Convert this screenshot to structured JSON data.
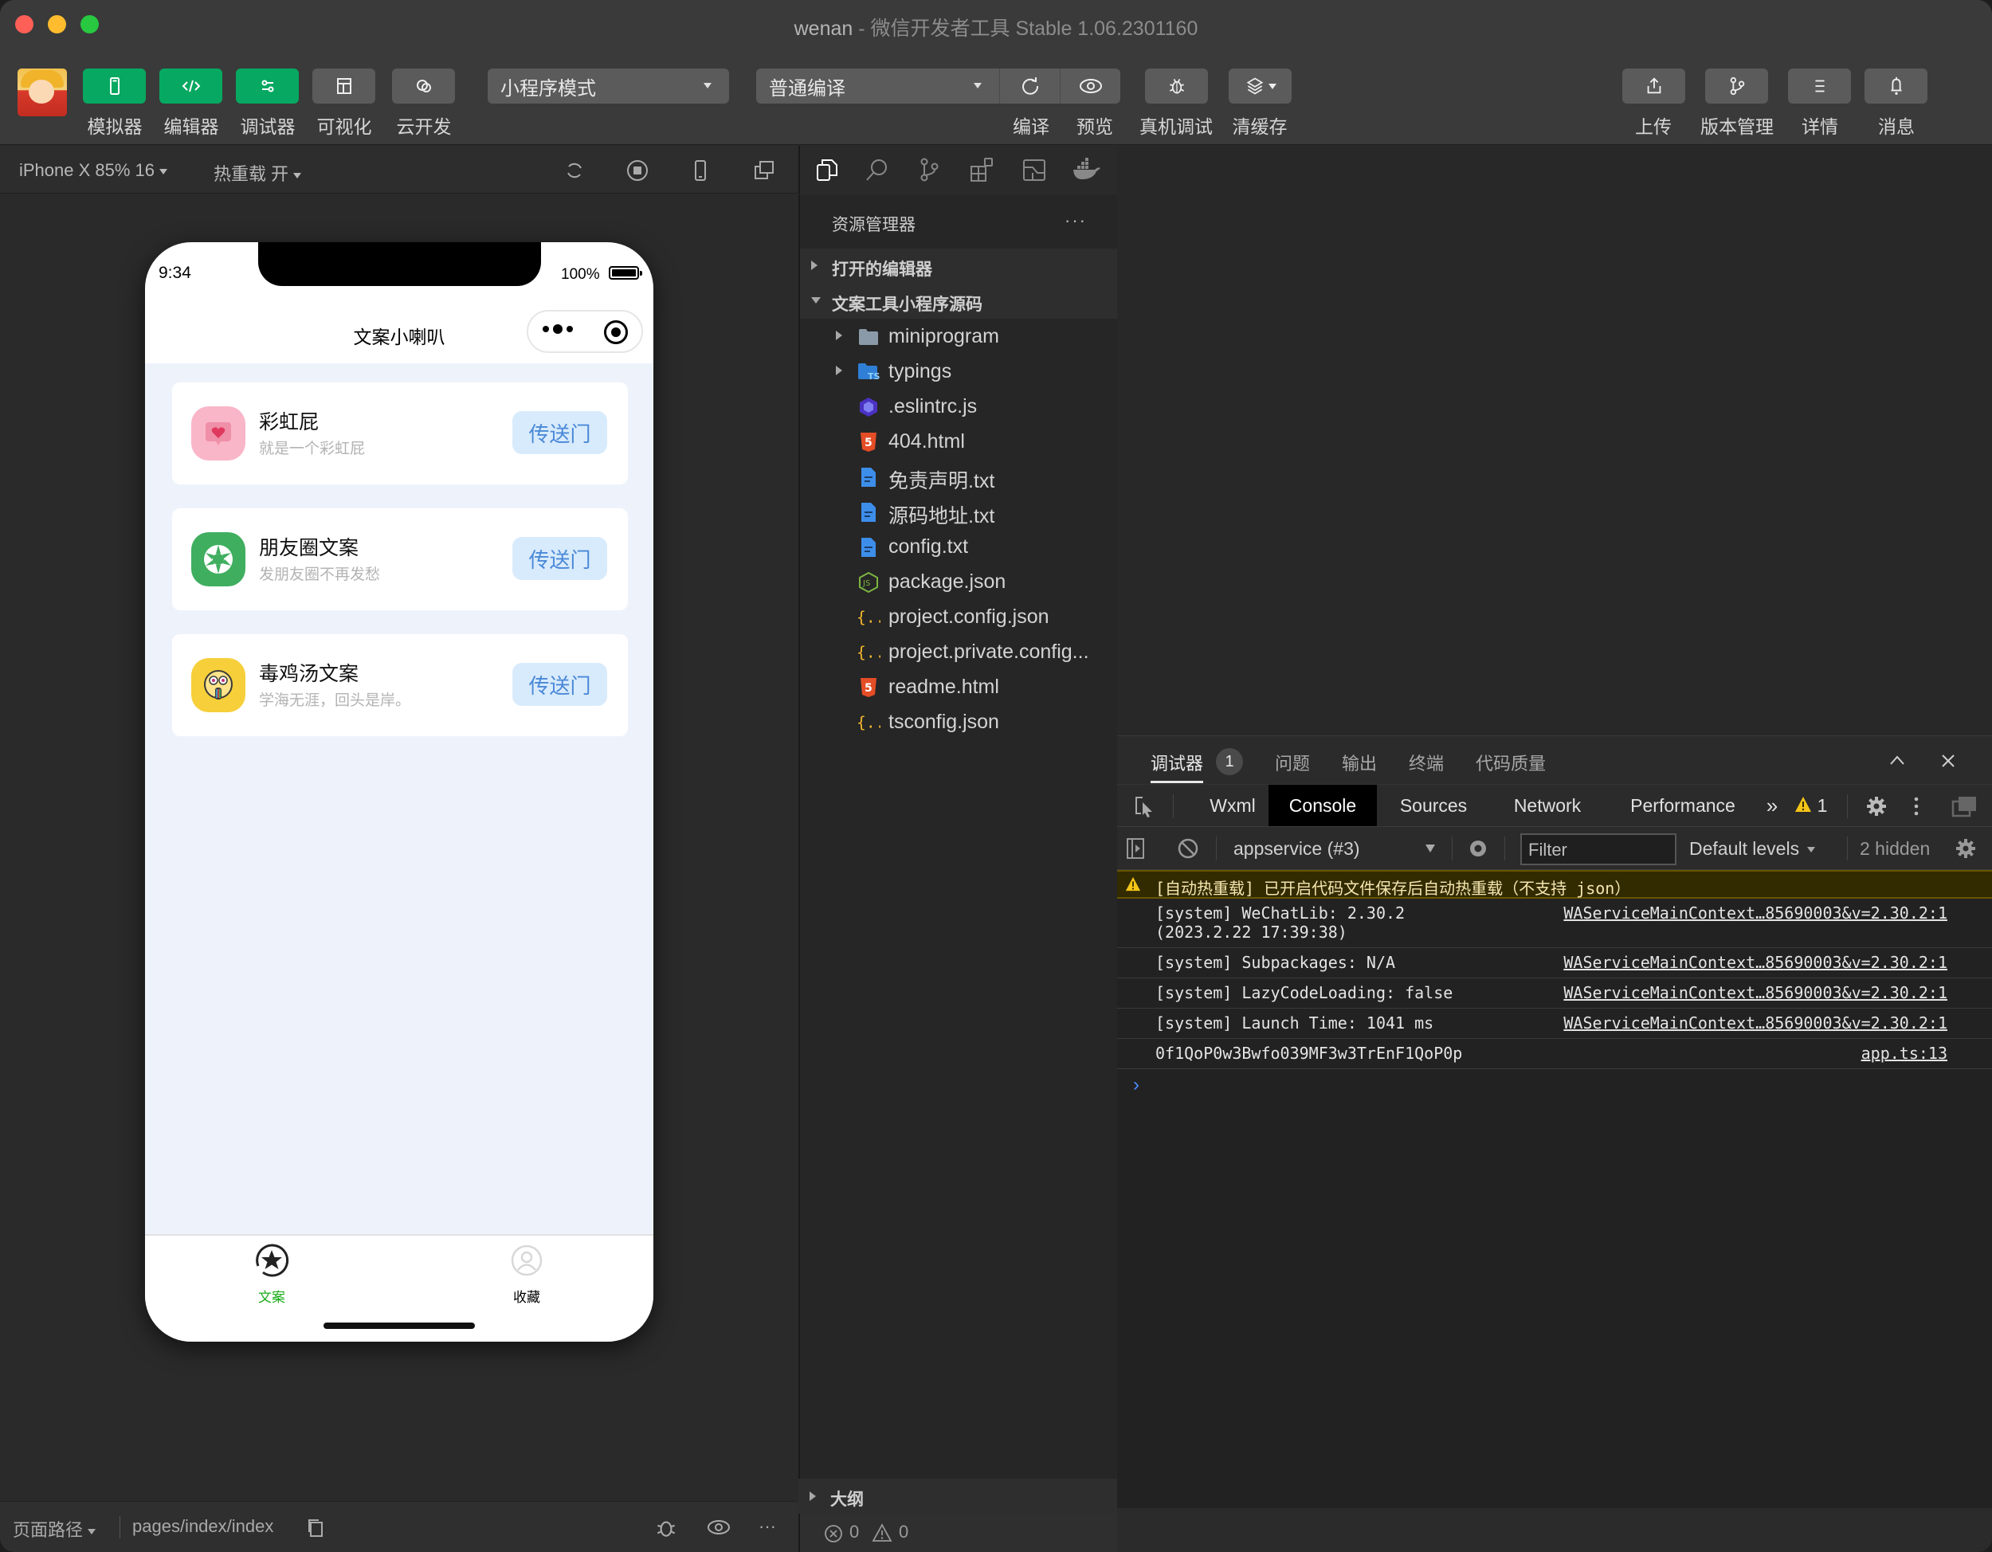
{
  "window": {
    "project_name": "wenan",
    "title_separator": " - ",
    "app_title": "微信开发者工具 Stable 1.06.2301160"
  },
  "toolbar": {
    "left_buttons": [
      {
        "label": "模拟器",
        "icon": "phone-icon",
        "active": true
      },
      {
        "label": "编辑器",
        "icon": "code-icon",
        "active": true
      },
      {
        "label": "调试器",
        "icon": "debug-sliders-icon",
        "active": true
      },
      {
        "label": "可视化",
        "icon": "layout-icon",
        "active": false
      },
      {
        "label": "云开发",
        "icon": "cloud-icon",
        "active": false
      }
    ],
    "mode_select": "小程序模式",
    "compile_select": "普通编译",
    "middle_buttons": [
      {
        "label": "编译",
        "icon": "refresh-icon"
      },
      {
        "label": "预览",
        "icon": "eye-icon"
      },
      {
        "label": "真机调试",
        "icon": "bug-icon"
      },
      {
        "label": "清缓存",
        "icon": "layers-icon"
      }
    ],
    "right_buttons": [
      {
        "label": "上传",
        "icon": "upload-icon"
      },
      {
        "label": "版本管理",
        "icon": "branch-icon"
      },
      {
        "label": "详情",
        "icon": "menu-icon"
      },
      {
        "label": "消息",
        "icon": "bell-icon"
      }
    ],
    "active_color": "#07a861",
    "inactive_color": "#5b5b5b"
  },
  "simulator_bar": {
    "device": "iPhone X 85% 16",
    "hot_reload": "热重载 开"
  },
  "phone": {
    "time": "9:34",
    "battery": "100%",
    "nav_title": "文案小喇叭",
    "cards": [
      {
        "title": "彩虹屁",
        "subtitle": "就是一个彩虹屁",
        "button": "传送门",
        "icon": "heart-message-icon",
        "icon_bg": "#f9b6c8"
      },
      {
        "title": "朋友圈文案",
        "subtitle": "发朋友圈不再发愁",
        "button": "传送门",
        "icon": "camera-aperture-icon",
        "icon_bg": "#3fae5f"
      },
      {
        "title": "毒鸡汤文案",
        "subtitle": "学海无涯，回头是岸。",
        "button": "传送门",
        "icon": "crazy-face-icon",
        "icon_bg": "#f6cf3a"
      }
    ],
    "tabs": [
      {
        "label": "文案",
        "active": true,
        "color": "#1aad19"
      },
      {
        "label": "收藏",
        "active": false,
        "color": "#000000"
      }
    ]
  },
  "footer": {
    "page_path_label": "页面路径",
    "page_path": "pages/index/index",
    "errors": "0",
    "warnings": "0"
  },
  "explorer": {
    "title": "资源管理器",
    "more": "···",
    "open_editors": "打开的编辑器",
    "project": "文案工具小程序源码",
    "outline": "大纲",
    "items": [
      {
        "name": "miniprogram",
        "type": "folder",
        "icon": "folder-icon",
        "expandable": true
      },
      {
        "name": "typings",
        "type": "folder",
        "icon": "ts-folder-icon",
        "expandable": true
      },
      {
        "name": ".eslintrc.js",
        "type": "file",
        "icon": "eslint-icon",
        "expandable": false
      },
      {
        "name": "404.html",
        "type": "file",
        "icon": "html5-icon",
        "expandable": false
      },
      {
        "name": "免责声明.txt",
        "type": "file",
        "icon": "text-file-icon",
        "expandable": false
      },
      {
        "name": "源码地址.txt",
        "type": "file",
        "icon": "text-file-icon",
        "expandable": false
      },
      {
        "name": "config.txt",
        "type": "file",
        "icon": "text-file-icon",
        "expandable": false
      },
      {
        "name": "package.json",
        "type": "file",
        "icon": "nodejs-icon",
        "expandable": false
      },
      {
        "name": "project.config.json",
        "type": "file",
        "icon": "json-icon",
        "expandable": false
      },
      {
        "name": "project.private.config...",
        "type": "file",
        "icon": "json-icon",
        "expandable": false
      },
      {
        "name": "readme.html",
        "type": "file",
        "icon": "html5-icon",
        "expandable": false
      },
      {
        "name": "tsconfig.json",
        "type": "file",
        "icon": "json-icon",
        "expandable": false
      }
    ]
  },
  "debugger": {
    "panel_tabs": [
      {
        "label": "调试器",
        "badge": "1",
        "active": true
      },
      {
        "label": "问题"
      },
      {
        "label": "输出"
      },
      {
        "label": "终端"
      },
      {
        "label": "代码质量"
      }
    ],
    "devtools_tabs": [
      "Wxml",
      "Console",
      "Sources",
      "Network",
      "Performance"
    ],
    "active_devtools_tab": "Console",
    "more_tabs": "»",
    "warning_count": "1",
    "context_select": "appservice (#3)",
    "filter_placeholder": "Filter",
    "levels_select": "Default levels",
    "hidden_count": "2 hidden",
    "logs": [
      {
        "level": "warning",
        "message": "[自动热重载] 已开启代码文件保存后自动热重载（不支持 json）",
        "source": ""
      },
      {
        "level": "info",
        "message": "[system] WeChatLib: 2.30.2\n(2023.2.22 17:39:38)",
        "source": "WAServiceMainContext…85690003&v=2.30.2:1"
      },
      {
        "level": "info",
        "message": "[system] Subpackages: N/A",
        "source": "WAServiceMainContext…85690003&v=2.30.2:1"
      },
      {
        "level": "info",
        "message": "[system] LazyCodeLoading: false",
        "source": "WAServiceMainContext…85690003&v=2.30.2:1"
      },
      {
        "level": "info",
        "message": "[system] Launch Time: 1041 ms",
        "source": "WAServiceMainContext…85690003&v=2.30.2:1"
      },
      {
        "level": "info",
        "message": "0f1QoP0w3Bwfo039MF3w3TrEnF1QoP0p",
        "source": "app.ts:13"
      }
    ],
    "prompt": "›"
  }
}
